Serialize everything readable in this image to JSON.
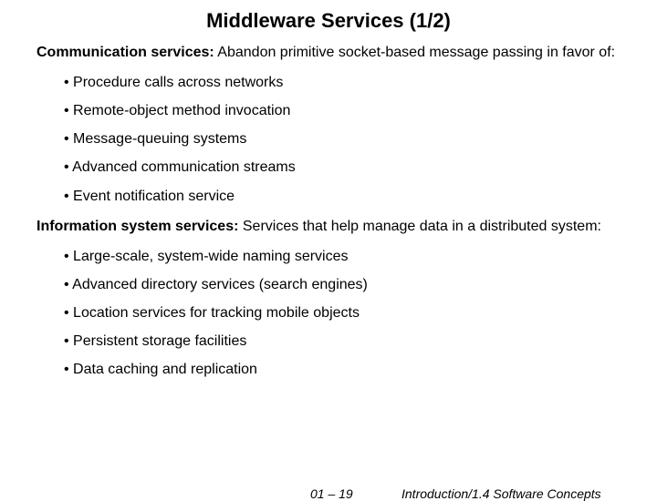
{
  "title": "Middleware Services (1/2)",
  "section1": {
    "label": "Communication services:",
    "text": " Abandon primitive socket-based message passing in favor of:",
    "bullets": [
      "Procedure calls across networks",
      "Remote-object method invocation",
      "Message-queuing systems",
      "Advanced communication streams",
      "Event notification service"
    ]
  },
  "section2": {
    "label": "Information system services:",
    "text": " Services that help manage data in a distributed system:",
    "bullets": [
      "Large-scale, system-wide naming services",
      "Advanced directory services (search engines)",
      "Location services for tracking mobile objects",
      "Persistent storage facilities",
      "Data caching and replication"
    ]
  },
  "footer": {
    "page": "01 – 19",
    "chapter": "Introduction/1.4 Software Concepts"
  }
}
